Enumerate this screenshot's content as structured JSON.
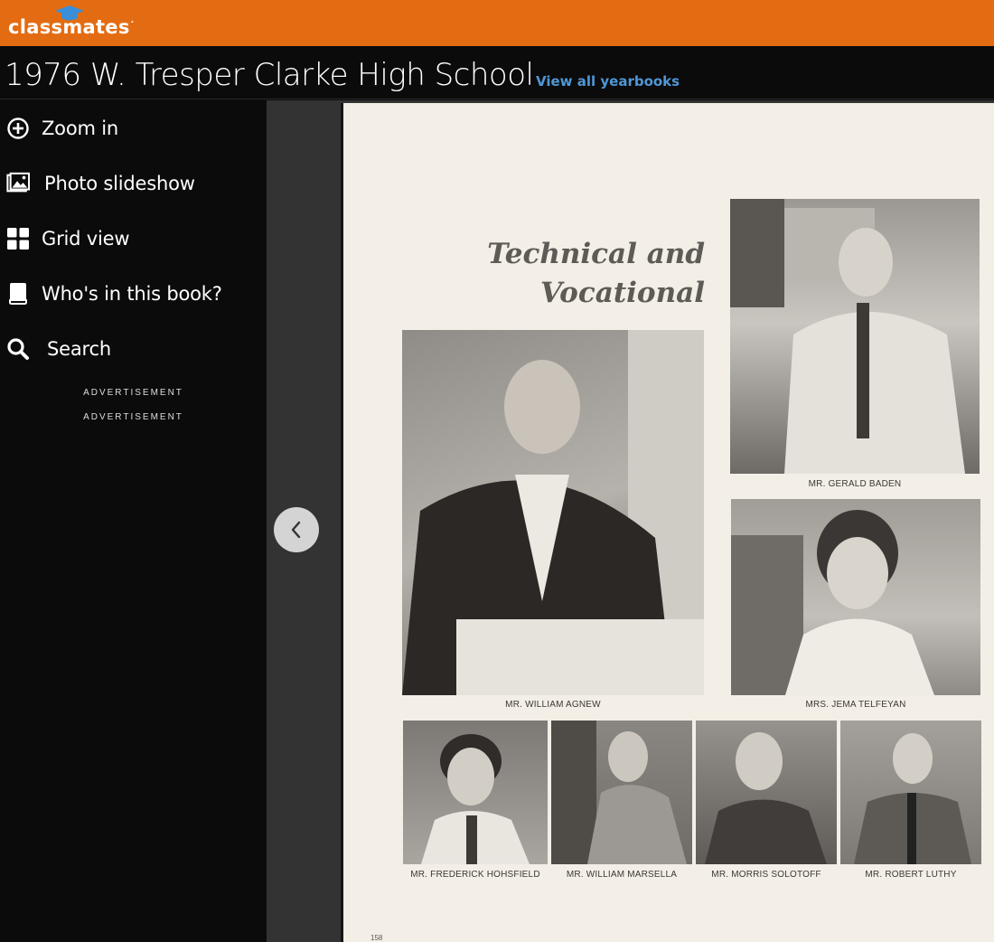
{
  "brand": {
    "logo_text": "classmates",
    "logo_mark": "."
  },
  "header": {
    "title": "1976 W. Tresper Clarke High School",
    "view_all_link": "View all yearbooks"
  },
  "sidebar": {
    "items": [
      {
        "label": "Zoom in",
        "icon": "zoom-in-icon"
      },
      {
        "label": "Photo slideshow",
        "icon": "slideshow-icon"
      },
      {
        "label": "Grid view",
        "icon": "grid-icon"
      },
      {
        "label": "Who's in this book?",
        "icon": "book-icon"
      },
      {
        "label": "Search",
        "icon": "search-icon"
      }
    ],
    "ads": [
      "ADVERTISEMENT",
      "ADVERTISEMENT"
    ]
  },
  "viewer": {
    "prev_icon": "chevron-left-icon",
    "page": {
      "title_line1": "Technical and",
      "title_line2": "Vocational",
      "captions": {
        "baden": "MR. GERALD BADEN",
        "agnew": "MR. WILLIAM AGNEW",
        "telfeyan": "MRS. JEMA TELFEYAN",
        "hohsfield": "MR. FREDERICK HOHSFIELD",
        "marsella": "MR. WILLIAM MARSELLA",
        "solotoff": "MR. MORRIS SOLOTOFF",
        "luthy": "MR. ROBERT LUTHY"
      },
      "page_number": "158"
    }
  },
  "colors": {
    "brand_orange": "#e36c12",
    "link_blue": "#4f97d6",
    "page_paper": "#f3efe6"
  }
}
